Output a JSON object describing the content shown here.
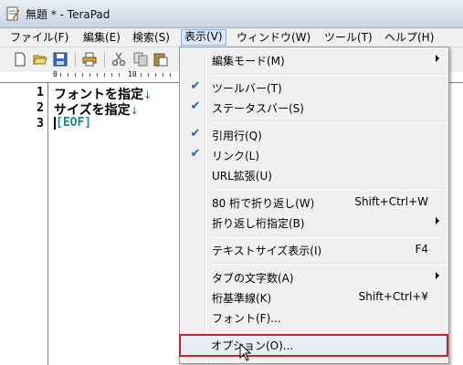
{
  "window": {
    "title": "無題 * - TeraPad"
  },
  "menubar": {
    "items": [
      "ファイル(F)",
      "編集(E)",
      "検索(S)",
      "表示(V)",
      "ウィンドウ(W)",
      "ツール(T)",
      "ヘルプ(H)"
    ],
    "active": "表示(V)"
  },
  "toolbar": {
    "icons": [
      "new-file-icon",
      "open-folder-icon",
      "save-icon",
      "print-icon",
      "cut-icon",
      "copy-icon",
      "paste-icon"
    ]
  },
  "ruler": {
    "labels": [
      "0",
      "10"
    ]
  },
  "editor": {
    "line_numbers": [
      "1",
      "2",
      "3"
    ],
    "lines": [
      "フォントを指定",
      "サイズを指定"
    ],
    "newline_mark": "↓",
    "eof": "[EOF]"
  },
  "view_menu": {
    "items": [
      {
        "label": "編集モード(M)",
        "shortcut": "",
        "checked": false,
        "submenu": true
      },
      {
        "label": "ツールバー(T)",
        "shortcut": "",
        "checked": true,
        "submenu": false
      },
      {
        "label": "ステータスバー(S)",
        "shortcut": "",
        "checked": true,
        "submenu": false
      },
      {
        "label": "引用行(Q)",
        "shortcut": "",
        "checked": true,
        "submenu": false
      },
      {
        "label": "リンク(L)",
        "shortcut": "",
        "checked": true,
        "submenu": false
      },
      {
        "label": "URL拡張(U)",
        "shortcut": "",
        "checked": false,
        "submenu": false
      },
      {
        "label": "80 桁で折り返し(W)",
        "shortcut": "Shift+Ctrl+W",
        "checked": false,
        "submenu": false
      },
      {
        "label": "折り返し桁指定(B)",
        "shortcut": "",
        "checked": false,
        "submenu": true
      },
      {
        "label": "テキストサイズ表示(I)",
        "shortcut": "F4",
        "checked": false,
        "submenu": false
      },
      {
        "label": "タブの文字数(A)",
        "shortcut": "",
        "checked": false,
        "submenu": true
      },
      {
        "label": "桁基準線(K)",
        "shortcut": "Shift+Ctrl+¥",
        "checked": false,
        "submenu": false
      },
      {
        "label": "フォント(F)...",
        "shortcut": "",
        "checked": false,
        "submenu": false
      },
      {
        "label": "オプション(O)...",
        "shortcut": "",
        "checked": false,
        "submenu": false,
        "highlighted": true
      }
    ],
    "check_glyph": "✔"
  },
  "colors": {
    "highlight_border": "#c0282e",
    "check": "#1c5cc4",
    "eof": "#1a8c8c"
  }
}
